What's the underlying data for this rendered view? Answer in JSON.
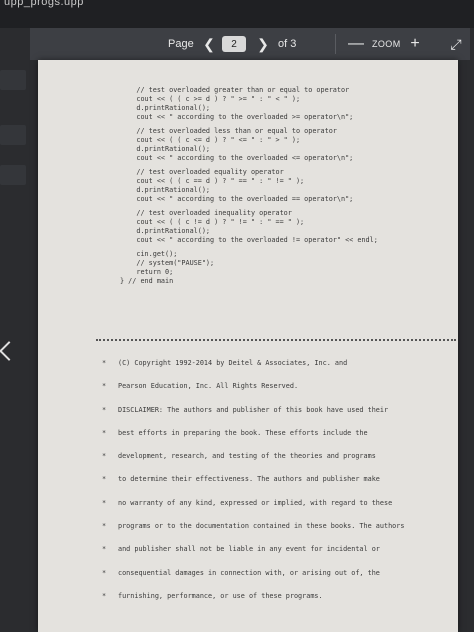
{
  "app": {
    "title": "upp_progs.upp"
  },
  "toolbar": {
    "page_label": "Page",
    "current_page": "2",
    "of_label": "of 3",
    "zoom_label": "ZOOM",
    "prev_icon": "chevron-left-icon",
    "next_icon": "chevron-right-icon",
    "zoom_out_icon": "minus-icon",
    "zoom_in_icon": "plus-icon",
    "expand_icon": "expand-icon"
  },
  "code": {
    "lines": [
      "    // test overloaded greater than or equal to operator",
      "    cout << ( ( c >= d ) ? \" >= \" : \" < \" );",
      "    d.printRational();",
      "    cout << \" according to the overloaded >= operator\\n\";",
      "",
      "    // test overloaded less than or equal to operator",
      "    cout << ( ( c <= d ) ? \" <= \" : \" > \" );",
      "    d.printRational();",
      "    cout << \" according to the overloaded <= operator\\n\";",
      "",
      "    // test overloaded equality operator",
      "    cout << ( ( c == d ) ? \" == \" : \" != \" );",
      "    d.printRational();",
      "    cout << \" according to the overloaded == operator\\n\";",
      "",
      "    // test overloaded inequality operator",
      "    cout << ( ( c != d ) ? \" != \" : \" == \" );",
      "    d.printRational();",
      "    cout << \" according to the overloaded != operator\" << endl;",
      "",
      "    cin.get();",
      "    // system(\"PAUSE\");",
      "    return 0;",
      "} // end main"
    ]
  },
  "notice": {
    "lines": [
      "(C) Copyright 1992-2014 by Deitel & Associates, Inc. and",
      "Pearson Education, Inc. All Rights Reserved.",
      "DISCLAIMER: The authors and publisher of this book have used their",
      "best efforts in preparing the book. These efforts include the",
      "development, research, and testing of the theories and programs",
      "to determine their effectiveness. The authors and publisher make",
      "no warranty of any kind, expressed or implied, with regard to these",
      "programs or to the documentation contained in these books. The authors",
      "and publisher shall not be liable in any event for incidental or",
      "consequential damages in connection with, or arising out of, the",
      "furnishing, performance, or use of these programs."
    ],
    "bullet": "*"
  }
}
